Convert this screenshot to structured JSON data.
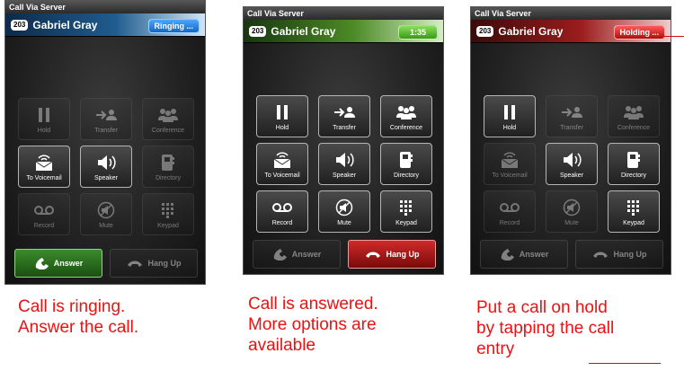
{
  "screens": [
    {
      "window_title": "Call Via Server",
      "extension": "203",
      "caller_name": "Gabriel Gray",
      "status": "Ringing ...",
      "buttons": {
        "hold": "Hold",
        "transfer": "Transfer",
        "conference": "Conference",
        "voicemail": "To Voicemail",
        "speaker": "Speaker",
        "directory": "Directory",
        "record": "Record",
        "mute": "Mute",
        "keypad": "Keypad"
      },
      "answer": "Answer",
      "hangup": "Hang Up",
      "caption": [
        "Call is ringing.",
        "Answer the call."
      ]
    },
    {
      "window_title": "Call Via Server",
      "extension": "203",
      "caller_name": "Gabriel Gray",
      "status": "1:35",
      "buttons": {
        "hold": "Hold",
        "transfer": "Transfer",
        "conference": "Conference",
        "voicemail": "To Voicemail",
        "speaker": "Speaker",
        "directory": "Directory",
        "record": "Record",
        "mute": "Mute",
        "keypad": "Keypad"
      },
      "answer": "Answer",
      "hangup": "Hang Up",
      "caption": [
        "Call is answered.",
        "More options are",
        "available"
      ]
    },
    {
      "window_title": "Call Via Server",
      "extension": "203",
      "caller_name": "Gabriel Gray",
      "status": "Holding ...",
      "buttons": {
        "hold": "Hold",
        "transfer": "Transfer",
        "conference": "Conference",
        "voicemail": "To Voicemail",
        "speaker": "Speaker",
        "directory": "Directory",
        "record": "Record",
        "mute": "Mute",
        "keypad": "Keypad"
      },
      "answer": "Answer",
      "hangup": "Hang Up",
      "caption": [
        "Put a call on hold",
        "by tapping the call",
        "entry"
      ]
    }
  ],
  "colors": {
    "ringing": "#1f5c8f",
    "answered": "#4c8a26",
    "holding": "#9b1c1c",
    "caption": "#ee1111"
  }
}
